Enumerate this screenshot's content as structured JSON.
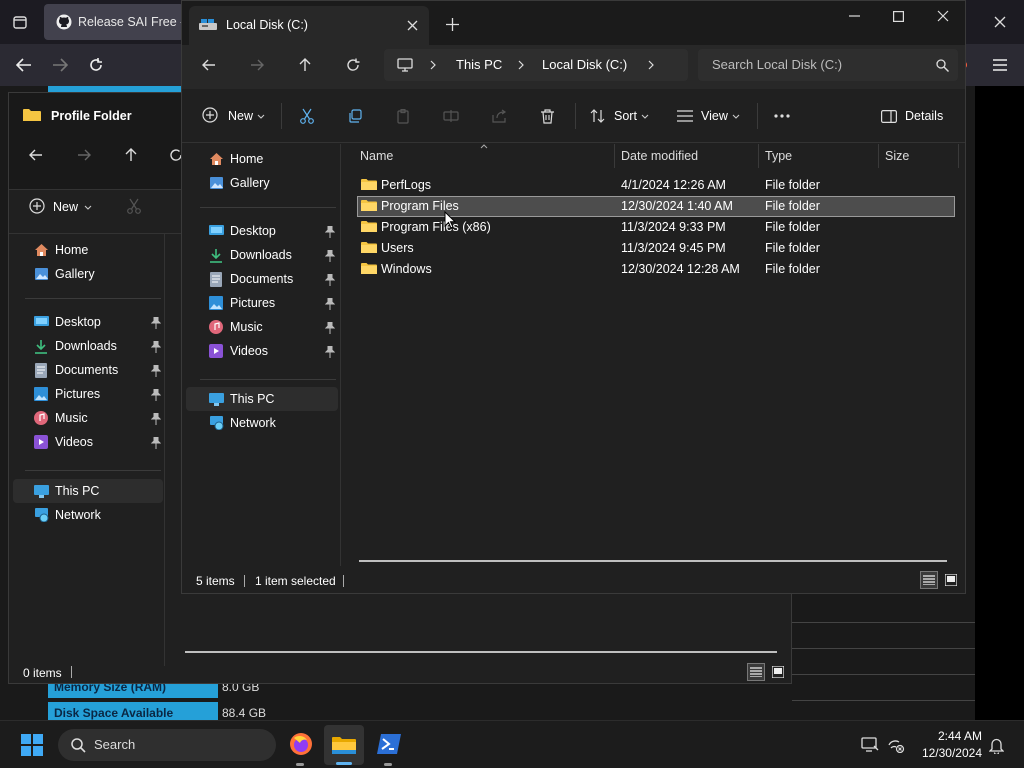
{
  "browser": {
    "tab_title": "Release SAI Free - pj",
    "specs": [
      {
        "label": "Memory Size (RAM)",
        "value": "8.0 GB"
      },
      {
        "label": "Disk Space Available",
        "value": "88.4 GB"
      }
    ]
  },
  "back_window": {
    "title": "Profile Folder",
    "new_label": "New",
    "nav": {
      "home": "Home",
      "gallery": "Gallery",
      "desktop": "Desktop",
      "downloads": "Downloads",
      "documents": "Documents",
      "pictures": "Pictures",
      "music": "Music",
      "videos": "Videos",
      "thispc": "This PC",
      "network": "Network"
    },
    "status": "0 items"
  },
  "main_window": {
    "tab_title": "Local Disk (C:)",
    "breadcrumb": [
      "This PC",
      "Local Disk (C:)"
    ],
    "search_placeholder": "Search Local Disk (C:)",
    "toolbar": {
      "new": "New",
      "sort": "Sort",
      "view": "View",
      "details": "Details"
    },
    "nav": {
      "home": "Home",
      "gallery": "Gallery",
      "desktop": "Desktop",
      "downloads": "Downloads",
      "documents": "Documents",
      "pictures": "Pictures",
      "music": "Music",
      "videos": "Videos",
      "thispc": "This PC",
      "network": "Network"
    },
    "columns": {
      "name": "Name",
      "date": "Date modified",
      "type": "Type",
      "size": "Size"
    },
    "files": [
      {
        "name": "PerfLogs",
        "date": "4/1/2024 12:26 AM",
        "type": "File folder"
      },
      {
        "name": "Program Files",
        "date": "12/30/2024 1:40 AM",
        "type": "File folder"
      },
      {
        "name": "Program Files (x86)",
        "date": "11/3/2024 9:33 PM",
        "type": "File folder"
      },
      {
        "name": "Users",
        "date": "11/3/2024 9:45 PM",
        "type": "File folder"
      },
      {
        "name": "Windows",
        "date": "12/30/2024 12:28 AM",
        "type": "File folder"
      }
    ],
    "status": {
      "count": "5 items",
      "selected": "1 item selected"
    }
  },
  "taskbar": {
    "search_label": "Search",
    "time": "2:44 AM",
    "date": "12/30/2024"
  },
  "colors": {
    "accent": "#25a0d8",
    "folder": "#f5c542",
    "selection": "#4d4d4d"
  }
}
